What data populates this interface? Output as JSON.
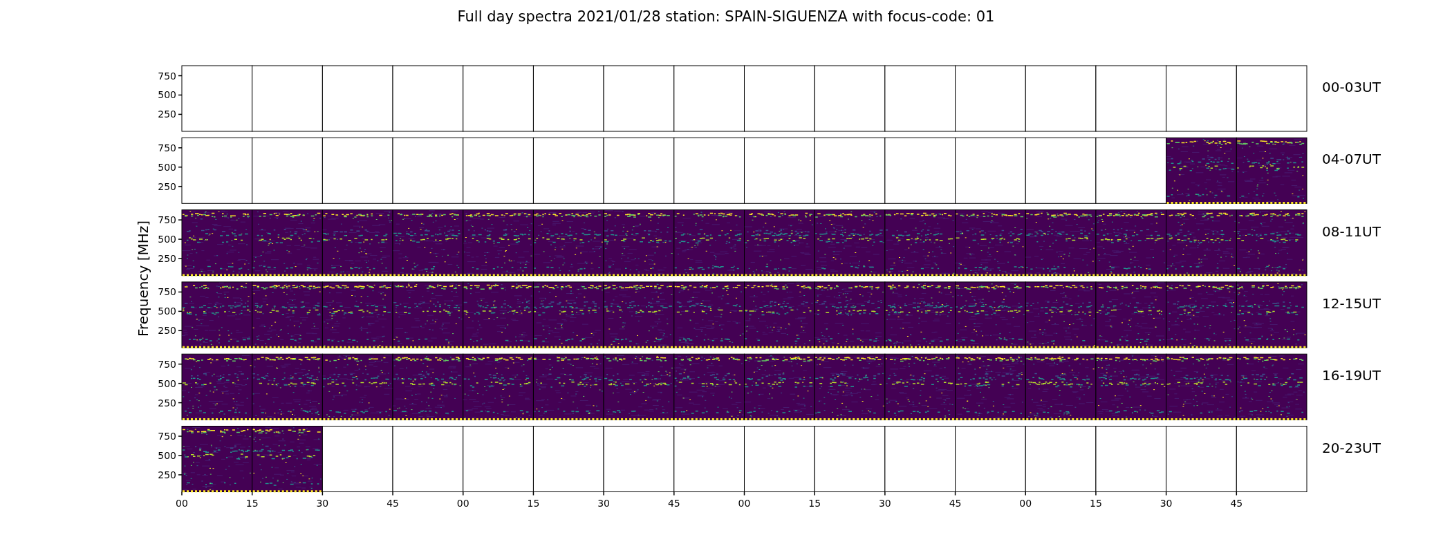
{
  "title": "Full day spectra 2021/01/28 station: SPAIN-SIGUENZA with focus-code: 01",
  "ylabel": "Frequency [MHz]",
  "xticks": [
    "00",
    "15",
    "30",
    "45",
    "00",
    "15",
    "30",
    "45",
    "00",
    "15",
    "30",
    "45",
    "00",
    "15",
    "30",
    "45"
  ],
  "rows": [
    {
      "label": "00-03UT",
      "yticks": [
        "750",
        "500",
        "250"
      ],
      "panels": [
        {
          "filled": false
        },
        {
          "filled": false
        },
        {
          "filled": false
        },
        {
          "filled": false
        },
        {
          "filled": false
        },
        {
          "filled": false
        },
        {
          "filled": false
        },
        {
          "filled": false
        },
        {
          "filled": false
        },
        {
          "filled": false
        },
        {
          "filled": false
        },
        {
          "filled": false
        },
        {
          "filled": false
        },
        {
          "filled": false
        },
        {
          "filled": false
        },
        {
          "filled": false
        }
      ]
    },
    {
      "label": "04-07UT",
      "yticks": [
        "750",
        "500",
        "250"
      ],
      "panels": [
        {
          "filled": false
        },
        {
          "filled": false
        },
        {
          "filled": false
        },
        {
          "filled": false
        },
        {
          "filled": false
        },
        {
          "filled": false
        },
        {
          "filled": false
        },
        {
          "filled": false
        },
        {
          "filled": false
        },
        {
          "filled": false
        },
        {
          "filled": false
        },
        {
          "filled": false
        },
        {
          "filled": false
        },
        {
          "filled": false
        },
        {
          "filled": true
        },
        {
          "filled": true
        }
      ]
    },
    {
      "label": "08-11UT",
      "yticks": [
        "750",
        "500",
        "250"
      ],
      "panels": [
        {
          "filled": true
        },
        {
          "filled": true
        },
        {
          "filled": true
        },
        {
          "filled": true
        },
        {
          "filled": true
        },
        {
          "filled": true
        },
        {
          "filled": true
        },
        {
          "filled": true
        },
        {
          "filled": true
        },
        {
          "filled": true
        },
        {
          "filled": true
        },
        {
          "filled": true
        },
        {
          "filled": true
        },
        {
          "filled": true
        },
        {
          "filled": true
        },
        {
          "filled": true
        }
      ]
    },
    {
      "label": "12-15UT",
      "yticks": [
        "750",
        "500",
        "250"
      ],
      "panels": [
        {
          "filled": true
        },
        {
          "filled": true
        },
        {
          "filled": true
        },
        {
          "filled": true
        },
        {
          "filled": true
        },
        {
          "filled": true
        },
        {
          "filled": true
        },
        {
          "filled": true
        },
        {
          "filled": true
        },
        {
          "filled": true
        },
        {
          "filled": true
        },
        {
          "filled": true
        },
        {
          "filled": true
        },
        {
          "filled": true
        },
        {
          "filled": true
        },
        {
          "filled": true
        }
      ]
    },
    {
      "label": "16-19UT",
      "yticks": [
        "750",
        "500",
        "250"
      ],
      "panels": [
        {
          "filled": true
        },
        {
          "filled": true
        },
        {
          "filled": true
        },
        {
          "filled": true
        },
        {
          "filled": true
        },
        {
          "filled": true
        },
        {
          "filled": true
        },
        {
          "filled": true
        },
        {
          "filled": true
        },
        {
          "filled": true
        },
        {
          "filled": true
        },
        {
          "filled": true
        },
        {
          "filled": true
        },
        {
          "filled": true
        },
        {
          "filled": true
        },
        {
          "filled": true
        }
      ]
    },
    {
      "label": "20-23UT",
      "yticks": [
        "750",
        "500",
        "250"
      ],
      "panels": [
        {
          "filled": true
        },
        {
          "filled": true
        },
        {
          "filled": false
        },
        {
          "filled": false
        },
        {
          "filled": false
        },
        {
          "filled": false
        },
        {
          "filled": false
        },
        {
          "filled": false
        },
        {
          "filled": false
        },
        {
          "filled": false
        },
        {
          "filled": false
        },
        {
          "filled": false
        },
        {
          "filled": false
        },
        {
          "filled": false
        },
        {
          "filled": false
        },
        {
          "filled": false
        }
      ]
    }
  ]
}
